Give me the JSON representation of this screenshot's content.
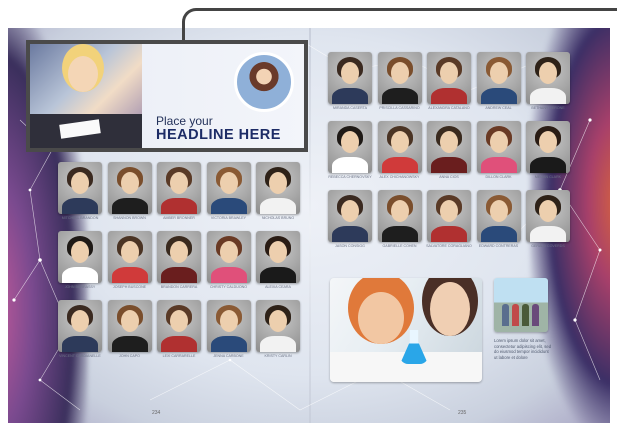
{
  "banner": {
    "headline_line1": "Place your",
    "headline_line2": "HEADLINE HERE"
  },
  "left_page": {
    "students": [
      {
        "name": "MITCHELL BRANDON"
      },
      {
        "name": "SHANNON BROWN"
      },
      {
        "name": "AMBER BRONNER"
      },
      {
        "name": "VICTORIA BRAWLEY"
      },
      {
        "name": "NICHOLAS BRUNO"
      },
      {
        "name": "JOHN BURRASSY"
      },
      {
        "name": "JOSEPH BUSCONE"
      },
      {
        "name": "BRANDON CARRERA"
      },
      {
        "name": "CHRISTY CALDUONO"
      },
      {
        "name": "ALEXIA CEARA"
      },
      {
        "name": "VINCENT CARDIANELLE"
      },
      {
        "name": "JOHN CAPO"
      },
      {
        "name": "LEXI CARRARELLE"
      },
      {
        "name": "JENNA CARBONE"
      },
      {
        "name": "KRISTY CARLIN"
      }
    ],
    "page_number": "234"
  },
  "right_page": {
    "students": [
      {
        "name": "MIRANDA CASERTA"
      },
      {
        "name": "PRISCILLA CASSARINO"
      },
      {
        "name": "ALEXANDRA CATALANO"
      },
      {
        "name": "ANDREW CEAL"
      },
      {
        "name": "BETHANY CERONE"
      },
      {
        "name": "REBECCA CHERNOVSKY"
      },
      {
        "name": "ALEX CHICHANOWSKY"
      },
      {
        "name": "ANNA CIOS"
      },
      {
        "name": "DILLON CLARK"
      },
      {
        "name": "MEGAN CLARK"
      },
      {
        "name": "JASON CONSIGG"
      },
      {
        "name": "GABRIELLE COHEN"
      },
      {
        "name": "SALVATORE CORAGLIANO"
      },
      {
        "name": "EDWARD CONTRERAS"
      },
      {
        "name": "GERALD COVERDS"
      }
    ],
    "caption": "Lorem ipsum dolor sit amet, consectetur adipiscing elit, sed do eiusmod tempor incididunt ut labore et dolore",
    "page_number": "235"
  },
  "colors": {
    "headline": "#1d2c66",
    "frame": "#4a4a4a"
  }
}
